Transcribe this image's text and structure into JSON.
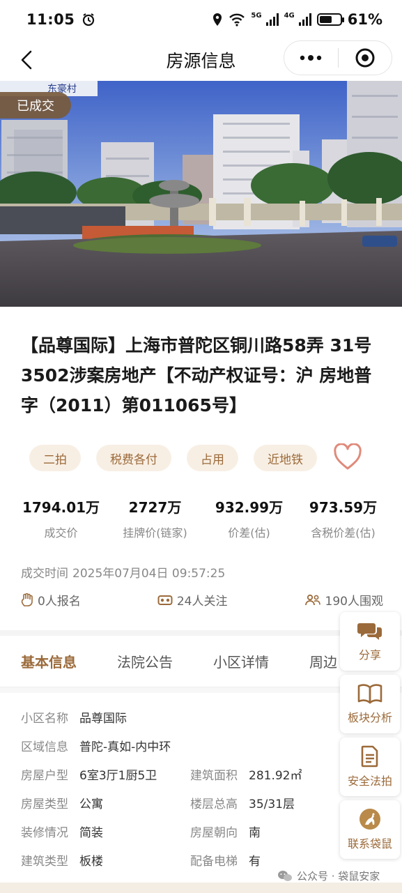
{
  "status_bar": {
    "time": "11:05",
    "network_a": "5G",
    "network_b": "4G",
    "battery_percent": "61%",
    "battery_level": 0.61
  },
  "nav": {
    "title": "房源信息",
    "more_icon": "more-dots-icon",
    "close_icon": "target-icon"
  },
  "hero": {
    "badge": "已成交",
    "sign_text": "东豪村"
  },
  "property": {
    "title": "【品尊国际】上海市普陀区铜川路58弄 31号3502涉案房地产【不动产权证号：沪 房地普字（2011）第011065号】",
    "tags": [
      "二拍",
      "税费各付",
      "占用",
      "近地铁"
    ],
    "favorite_icon": "heart-icon"
  },
  "stats": [
    {
      "value": "1794.01万",
      "label": "成交价"
    },
    {
      "value": "2727万",
      "label": "挂牌价(链家)"
    },
    {
      "value": "932.99万",
      "label": "价差(估)"
    },
    {
      "value": "973.59万",
      "label": "含税价差(估)"
    }
  ],
  "deal": {
    "label": "成交时间",
    "time": "2025年07月04日 09:57:25"
  },
  "counts": [
    {
      "icon": "hand-icon",
      "text": "0人报名"
    },
    {
      "icon": "vr-glasses-icon",
      "text": "24人关注"
    },
    {
      "icon": "people-icon",
      "text": "190人围观"
    }
  ],
  "tabs": [
    "基本信息",
    "法院公告",
    "小区详情",
    "周边"
  ],
  "basic_info": [
    [
      {
        "k": "小区名称",
        "v": "品尊国际"
      }
    ],
    [
      {
        "k": "区域信息",
        "v": "普陀-真如-内中环"
      }
    ],
    [
      {
        "k": "房屋户型",
        "v": "6室3厅1厨5卫"
      },
      {
        "k": "建筑面积",
        "v": "281.92㎡"
      }
    ],
    [
      {
        "k": "房屋类型",
        "v": "公寓"
      },
      {
        "k": "楼层总高",
        "v": "35/31层"
      }
    ],
    [
      {
        "k": "装修情况",
        "v": "简装"
      },
      {
        "k": "房屋朝向",
        "v": "南"
      }
    ],
    [
      {
        "k": "建筑类型",
        "v": "板楼"
      },
      {
        "k": "配备电梯",
        "v": "有"
      }
    ]
  ],
  "side_buttons": [
    {
      "label": "分享",
      "icon": "chat-bubble-icon"
    },
    {
      "label": "板块分析",
      "icon": "book-icon"
    },
    {
      "label": "安全法拍",
      "icon": "document-icon"
    },
    {
      "label": "联系袋鼠",
      "icon": "kangaroo-icon"
    }
  ],
  "watermark": "公众号 · 袋鼠安家",
  "colors": {
    "accent": "#9b6a3a",
    "tag_bg": "#f8efe4",
    "heart": "#e08a7a"
  }
}
